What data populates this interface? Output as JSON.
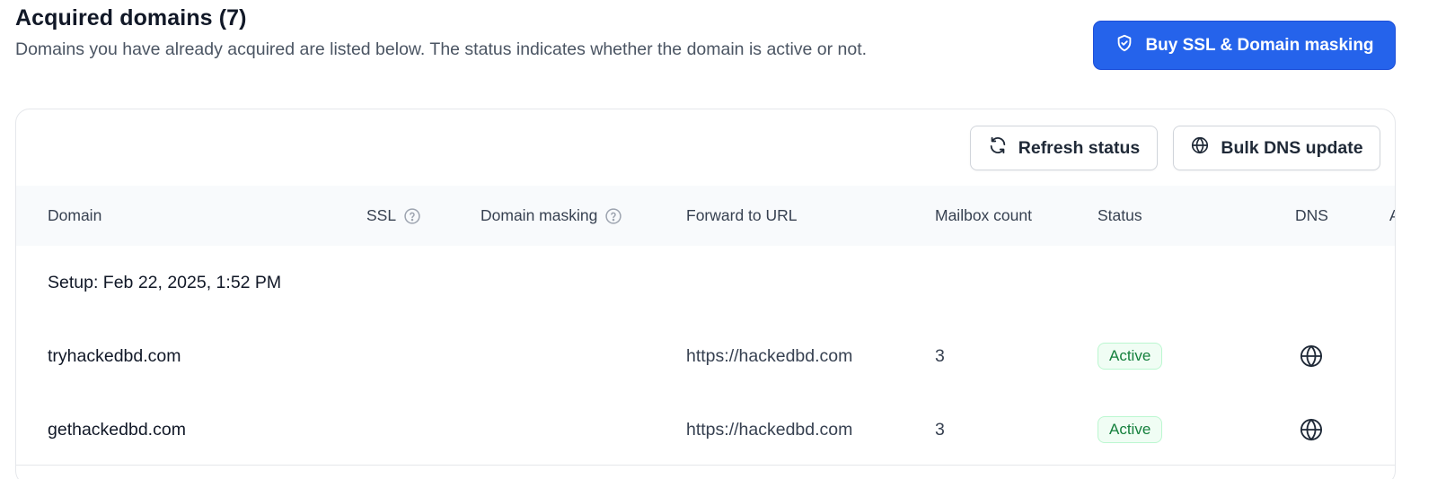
{
  "header": {
    "title": "Acquired domains (7)",
    "subtitle": "Domains you have already acquired are listed below. The status indicates whether the domain is active or not.",
    "buy_button_label": "Buy SSL & Domain masking"
  },
  "toolbar": {
    "refresh_label": "Refresh status",
    "bulk_dns_label": "Bulk DNS update"
  },
  "table": {
    "columns": [
      "Domain",
      "SSL",
      "Domain masking",
      "Forward to URL",
      "Mailbox count",
      "Status",
      "DNS",
      "A"
    ],
    "group_label": "Setup: Feb 22, 2025, 1:52 PM",
    "rows": [
      {
        "domain": "tryhackedbd.com",
        "forward_url": "https://hackedbd.com",
        "mailbox_count": "3",
        "status": "Active"
      },
      {
        "domain": "gethackedbd.com",
        "forward_url": "https://hackedbd.com",
        "mailbox_count": "3",
        "status": "Active"
      }
    ]
  },
  "icons": {
    "buy_button": "shield-check-icon",
    "refresh": "refresh-icon",
    "bulk_dns": "globe-icon",
    "help": "question-circle-icon",
    "dns": "globe-icon"
  },
  "colors": {
    "primary": "#2563eb",
    "status_active_bg": "#f0fdf4",
    "status_active_text": "#15803d",
    "table_header_bg": "#f8fafc"
  }
}
